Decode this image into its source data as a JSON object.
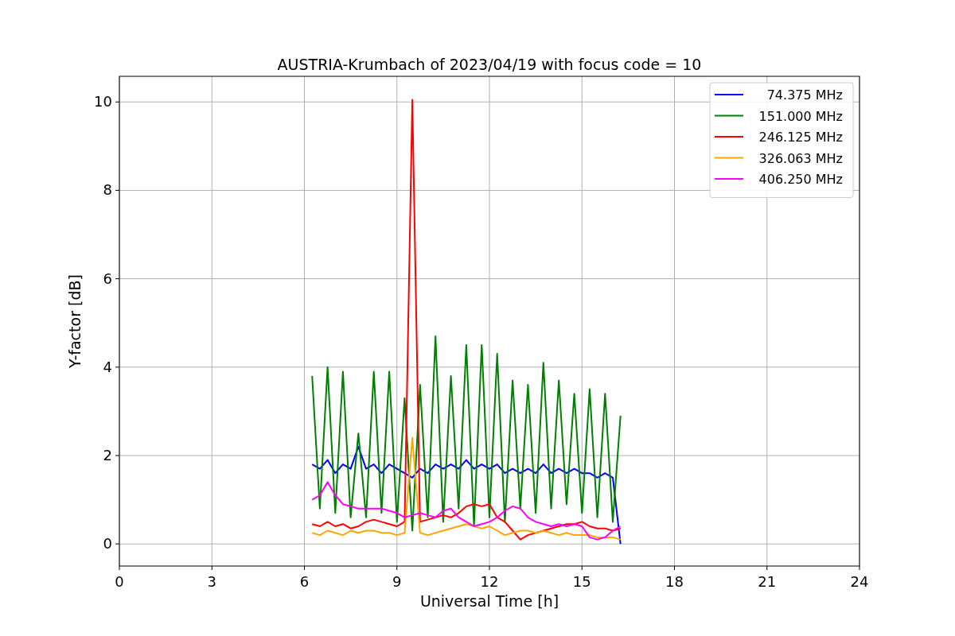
{
  "chart_data": {
    "type": "line",
    "title": "AUSTRIA-Krumbach of 2023/04/19 with focus code = 10",
    "xlabel": "Universal Time [h]",
    "ylabel": "Y-factor [dB]",
    "x": [
      6.25,
      6.5,
      6.75,
      7.0,
      7.25,
      7.5,
      7.75,
      8.0,
      8.25,
      8.5,
      8.75,
      9.0,
      9.25,
      9.5,
      9.75,
      10.0,
      10.25,
      10.5,
      10.75,
      11.0,
      11.25,
      11.5,
      11.75,
      12.0,
      12.25,
      12.5,
      12.75,
      13.0,
      13.25,
      13.5,
      13.75,
      14.0,
      14.25,
      14.5,
      14.75,
      15.0,
      15.25,
      15.5,
      15.75,
      16.0,
      16.25
    ],
    "series": [
      {
        "name": "74.375 MHz",
        "color": "#0000ff",
        "values": [
          1.8,
          1.7,
          1.9,
          1.6,
          1.8,
          1.7,
          2.2,
          1.7,
          1.8,
          1.6,
          1.8,
          1.7,
          1.6,
          1.5,
          1.7,
          1.6,
          1.8,
          1.7,
          1.8,
          1.7,
          1.9,
          1.7,
          1.8,
          1.7,
          1.8,
          1.6,
          1.7,
          1.6,
          1.7,
          1.6,
          1.8,
          1.6,
          1.7,
          1.6,
          1.7,
          1.6,
          1.6,
          1.5,
          1.6,
          1.5,
          0.0
        ]
      },
      {
        "name": "151.000 MHz",
        "color": "#008000",
        "values": [
          3.8,
          0.8,
          4.0,
          0.7,
          3.9,
          0.6,
          2.5,
          0.6,
          3.9,
          0.7,
          3.9,
          0.5,
          3.3,
          0.3,
          3.6,
          0.6,
          4.7,
          0.5,
          3.8,
          0.8,
          4.5,
          0.4,
          4.5,
          0.6,
          4.3,
          0.5,
          3.7,
          0.8,
          3.6,
          0.7,
          4.1,
          0.8,
          3.7,
          0.9,
          3.4,
          0.7,
          3.5,
          0.6,
          3.4,
          0.5,
          2.9
        ]
      },
      {
        "name": "246.125 MHz",
        "color": "#ff0000",
        "values": [
          0.45,
          0.4,
          0.5,
          0.4,
          0.45,
          0.35,
          0.4,
          0.5,
          0.55,
          0.5,
          0.45,
          0.4,
          0.5,
          10.05,
          0.5,
          0.55,
          0.6,
          0.65,
          0.6,
          0.7,
          0.85,
          0.9,
          0.85,
          0.9,
          0.6,
          0.5,
          0.3,
          0.1,
          0.2,
          0.25,
          0.3,
          0.35,
          0.4,
          0.45,
          0.45,
          0.5,
          0.4,
          0.35,
          0.35,
          0.3,
          0.35
        ]
      },
      {
        "name": "326.063 MHz",
        "color": "#ffa500",
        "values": [
          0.25,
          0.2,
          0.3,
          0.25,
          0.2,
          0.3,
          0.25,
          0.3,
          0.3,
          0.25,
          0.25,
          0.2,
          0.25,
          2.4,
          0.25,
          0.2,
          0.25,
          0.3,
          0.35,
          0.4,
          0.45,
          0.4,
          0.35,
          0.4,
          0.3,
          0.2,
          0.25,
          0.3,
          0.3,
          0.25,
          0.3,
          0.25,
          0.2,
          0.25,
          0.2,
          0.2,
          0.2,
          0.15,
          0.15,
          0.15,
          0.1
        ]
      },
      {
        "name": "406.250 MHz",
        "color": "#ff00ff",
        "values": [
          1.0,
          1.1,
          1.4,
          1.1,
          0.9,
          0.85,
          0.8,
          0.8,
          0.8,
          0.8,
          0.75,
          0.7,
          0.6,
          0.65,
          0.7,
          0.65,
          0.6,
          0.75,
          0.8,
          0.6,
          0.5,
          0.4,
          0.45,
          0.5,
          0.6,
          0.75,
          0.85,
          0.8,
          0.6,
          0.5,
          0.45,
          0.4,
          0.45,
          0.4,
          0.45,
          0.4,
          0.15,
          0.1,
          0.15,
          0.3,
          0.4
        ]
      }
    ],
    "grid": true,
    "legend": true,
    "xlim": [
      0,
      24
    ],
    "ylim": [
      -0.5,
      10.58
    ],
    "xticks": [
      0,
      3,
      6,
      9,
      12,
      15,
      18,
      21,
      24
    ],
    "yticks": [
      0,
      2,
      4,
      6,
      8,
      10
    ]
  }
}
